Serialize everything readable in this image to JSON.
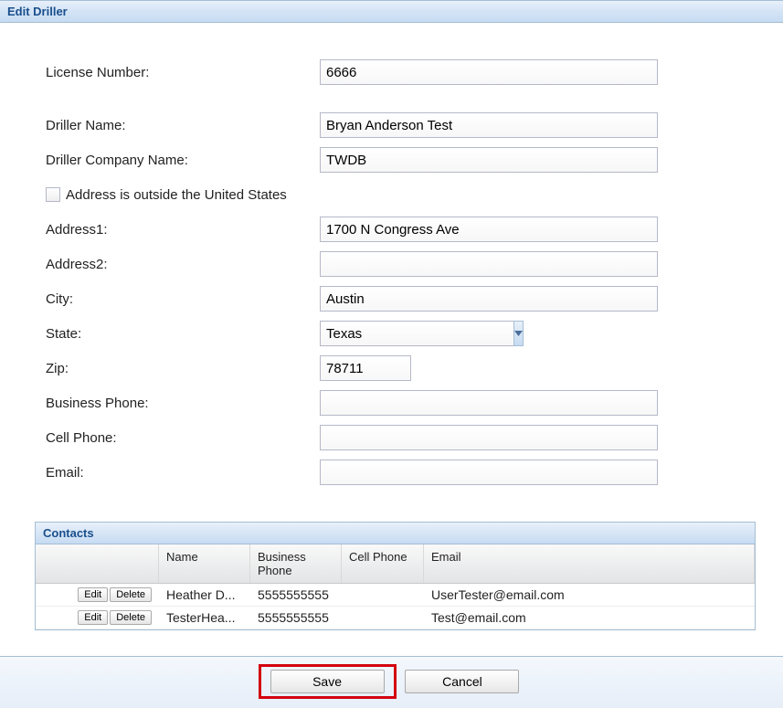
{
  "header": {
    "title": "Edit Driller"
  },
  "form": {
    "labels": {
      "license": "License Number:",
      "driller_name": "Driller Name:",
      "company": "Driller Company Name:",
      "outside_us": "Address is outside the United States",
      "address1": "Address1:",
      "address2": "Address2:",
      "city": "City:",
      "state": "State:",
      "zip": "Zip:",
      "bphone": "Business Phone:",
      "cphone": "Cell Phone:",
      "email": "Email:"
    },
    "values": {
      "license": "6666",
      "driller_name": "Bryan Anderson Test",
      "company": "TWDB",
      "outside_us_checked": false,
      "address1": "1700 N Congress Ave",
      "address2": "",
      "city": "Austin",
      "state": "Texas",
      "zip": "78711",
      "bphone": "",
      "cphone": "",
      "email": ""
    }
  },
  "contacts": {
    "title": "Contacts",
    "columns": {
      "name": "Name",
      "bphone": "Business Phone",
      "cphone": "Cell Phone",
      "email": "Email"
    },
    "row_buttons": {
      "edit": "Edit",
      "delete": "Delete"
    },
    "rows": [
      {
        "name": "Heather D...",
        "bphone": "5555555555",
        "cphone": "",
        "email": "UserTester@email.com"
      },
      {
        "name": "TesterHea...",
        "bphone": "5555555555",
        "cphone": "",
        "email": "Test@email.com"
      }
    ]
  },
  "footer": {
    "save": "Save",
    "cancel": "Cancel"
  }
}
